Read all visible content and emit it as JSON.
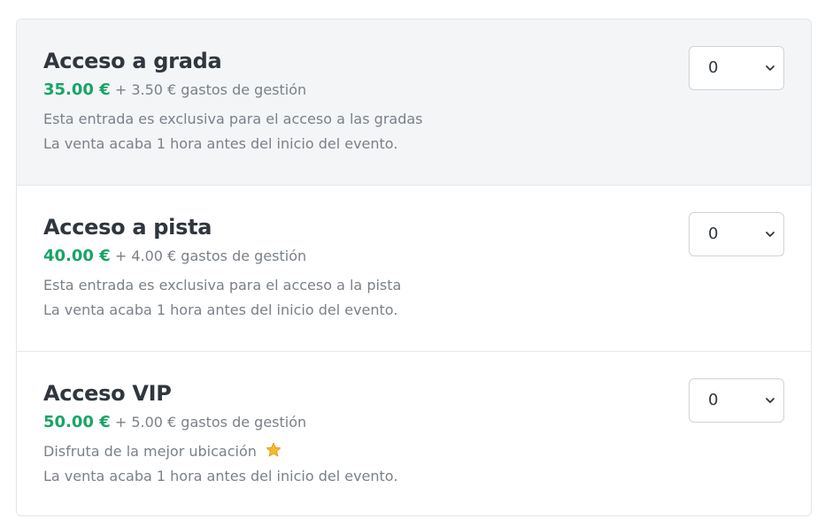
{
  "tickets": [
    {
      "name": "Acceso a grada",
      "price": "35.00 €",
      "fee": "+ 3.50 € gastos de gestión",
      "description": "Esta entrada es exclusiva para el acceso a las gradas",
      "sale_note": "La venta acaba 1 hora antes del inicio del evento.",
      "quantity": "0",
      "highlighted": true
    },
    {
      "name": "Acceso a pista",
      "price": "40.00 €",
      "fee": "+ 4.00 € gastos de gestión",
      "description": "Esta entrada es exclusiva para el acceso a la pista",
      "sale_note": "La venta acaba 1 hora antes del inicio del evento.",
      "quantity": "0",
      "highlighted": false
    },
    {
      "name": "Acceso VIP",
      "price": "50.00 €",
      "fee": "+ 5.00 € gastos de gestión",
      "description": "Disfruta de la mejor ubicación",
      "description_icon": "star-icon",
      "sale_note": "La venta acaba 1 hora antes del inicio del evento.",
      "quantity": "0",
      "highlighted": false
    }
  ],
  "colors": {
    "price": "#17a567",
    "title": "#2f363d",
    "muted": "#7a8188",
    "highlight_bg": "#f4f5f7",
    "star": "#f5b82e"
  }
}
